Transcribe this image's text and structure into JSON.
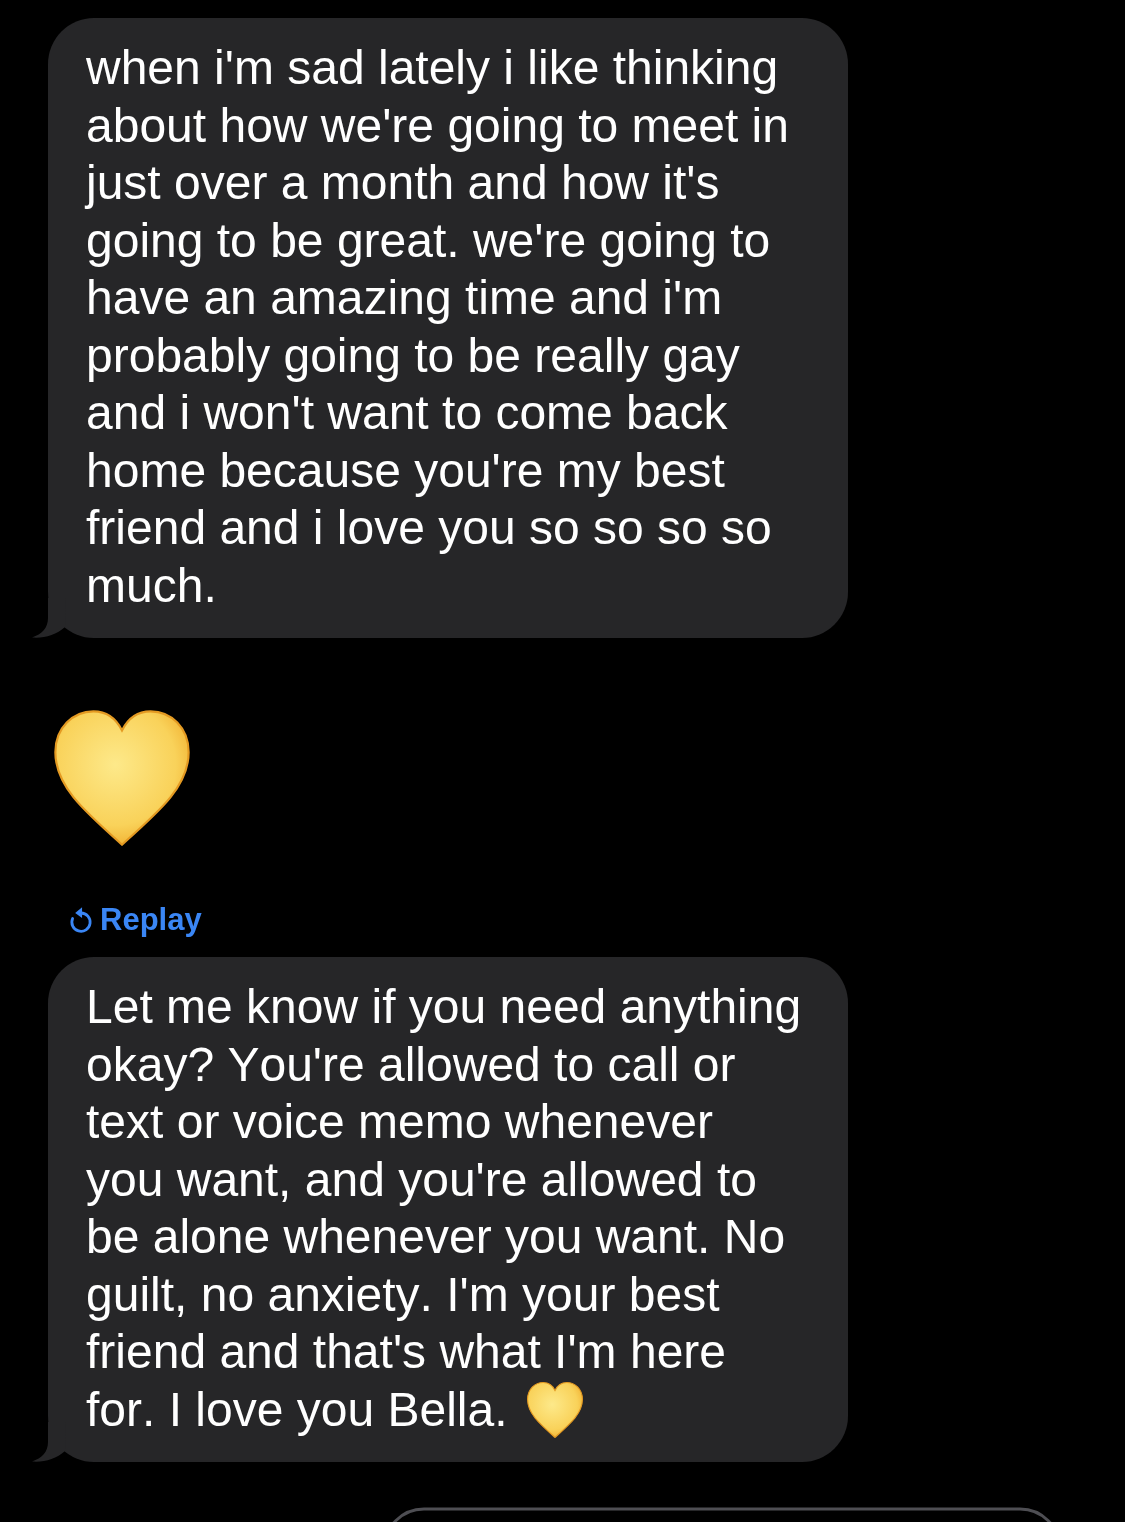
{
  "messages": [
    {
      "kind": "text",
      "tail": true,
      "text": "when i'm sad lately i like thinking about how we're going to meet in just over a month and how it's going to be great. we're going to have an amazing time and i'm probably going to be really gay and i won't want to come back home because you're my best friend and i love you so so so so much."
    },
    {
      "kind": "emoji"
    },
    {
      "kind": "text",
      "tail": true,
      "replay": "Replay",
      "trailing_emoji": true,
      "text": "Let me know if you need anything okay? You're allowed to call or text or voice memo whenever you want, and you're allowed to be alone whenever you want. No guilt, no anxiety. I'm your best friend and that's what I'm here for. I love you Bella."
    }
  ]
}
